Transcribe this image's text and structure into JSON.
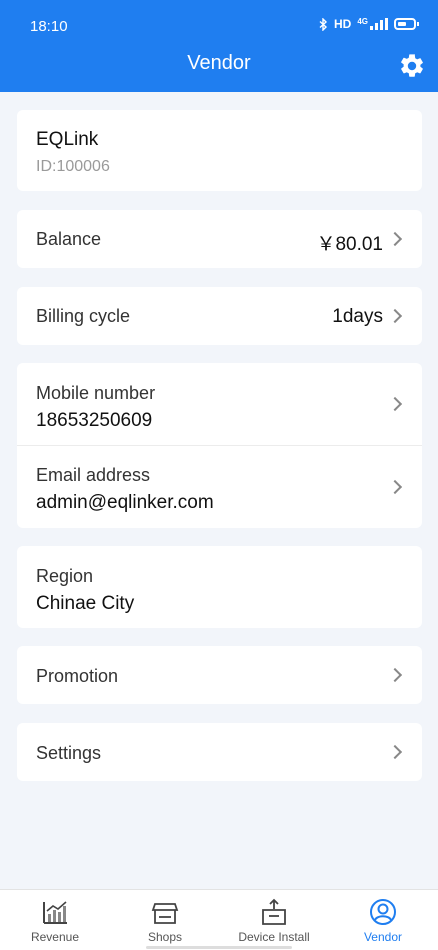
{
  "status": {
    "time": "18:10",
    "net_label": "HD",
    "net_type": "4G",
    "icons": [
      "bluetooth-icon",
      "hd-icon",
      "signal-icon",
      "battery-icon"
    ]
  },
  "header": {
    "title": "Vendor",
    "settings_icon": "gear-icon"
  },
  "profile": {
    "name": "EQLink",
    "id": "ID:100006"
  },
  "balance": {
    "label": "Balance",
    "value": "￥80.01"
  },
  "billing": {
    "label": "Billing cycle",
    "value": "1days"
  },
  "contact": {
    "mobile_label": "Mobile number",
    "mobile_value": "18653250609",
    "email_label": "Email address",
    "email_value": "admin@eqlinker.com"
  },
  "region": {
    "label": "Region",
    "value": "Chinae City"
  },
  "promotion": {
    "label": "Promotion"
  },
  "settings": {
    "label": "Settings"
  },
  "tabs": [
    {
      "label": "Revenue",
      "icon": "chart-icon",
      "active": false
    },
    {
      "label": "Shops",
      "icon": "shop-icon",
      "active": false
    },
    {
      "label": "Device Install",
      "icon": "device-install-icon",
      "active": false
    },
    {
      "label": "Vendor",
      "icon": "user-icon",
      "active": true
    }
  ],
  "colors": {
    "accent": "#1f7ef0",
    "background": "#f2f5fa"
  }
}
